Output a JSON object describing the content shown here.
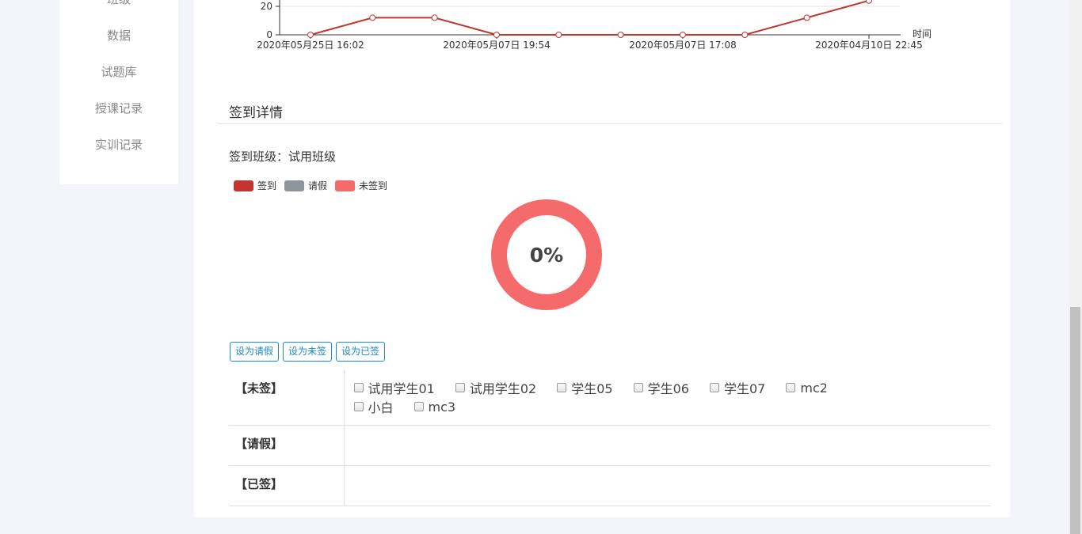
{
  "sidebar": {
    "items": [
      {
        "label": "班级"
      },
      {
        "label": "数据"
      },
      {
        "label": "试题库"
      },
      {
        "label": "授课记录"
      },
      {
        "label": "实训记录"
      }
    ]
  },
  "line_chart": {
    "y_ticks": [
      "0",
      "20"
    ],
    "x_unit": "时间",
    "x_ticks": [
      "2020年05月25日 16:02",
      "2020年05月07日 19:54",
      "2020年05月07日 17:08",
      "2020年04月10日 22:45"
    ],
    "line_color": "#c23531"
  },
  "attendance": {
    "section_title": "签到详情",
    "class_label": "签到班级：",
    "class_name": "试用班级",
    "legend": [
      {
        "label": "签到",
        "color": "#c23531"
      },
      {
        "label": "请假",
        "color": "#8f949c"
      },
      {
        "label": "未签到",
        "color": "#f56b6c"
      }
    ],
    "percent": "0%",
    "buttons": {
      "leave": "设为请假",
      "unsigned": "设为未签",
      "signed": "设为已签"
    },
    "groups": {
      "unsigned_label": "【未签】",
      "leave_label": "【请假】",
      "signed_label": "【已签】"
    },
    "unsigned_students": [
      "试用学生01",
      "试用学生02",
      "学生05",
      "学生06",
      "学生07",
      "mc2",
      "小白",
      "mc3"
    ]
  },
  "chart_data": {
    "type": "line",
    "x": [
      "2020年05月25日 16:02",
      "",
      "",
      "2020年05月07日 19:54",
      "",
      "",
      "2020年05月07日 17:08",
      "",
      "",
      "2020年04月10日 22:45"
    ],
    "values": [
      0,
      12,
      12,
      0,
      0,
      0,
      0,
      0,
      12,
      24
    ],
    "xlabel": "时间",
    "ylabel": "",
    "y_ticks_visible": [
      0,
      20
    ]
  }
}
